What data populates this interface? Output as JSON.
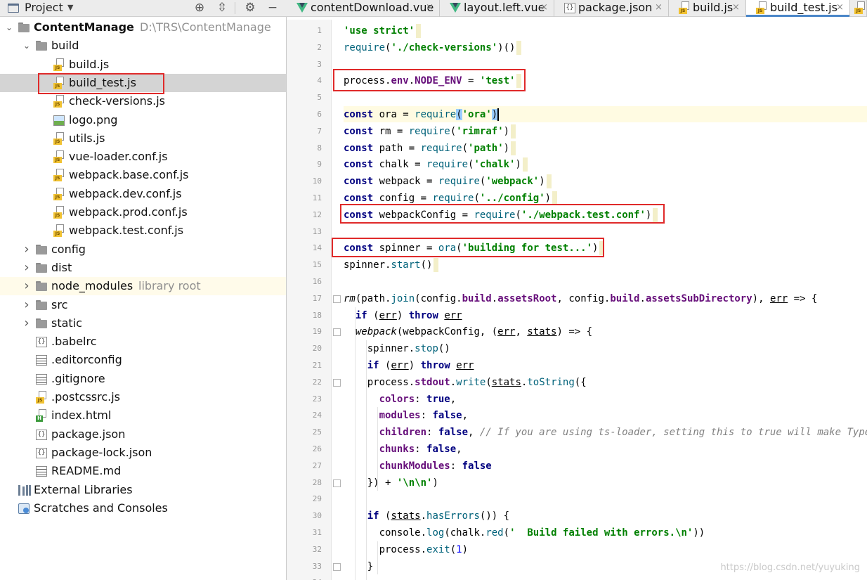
{
  "project_panel": {
    "title": "Project",
    "tree": [
      {
        "label": "ContentManage",
        "path": "D:\\TRS\\ContentManage",
        "type": "root-folder"
      },
      {
        "label": "build",
        "type": "folder"
      },
      {
        "label": "build.js",
        "type": "js"
      },
      {
        "label": "build_test.js",
        "type": "js"
      },
      {
        "label": "check-versions.js",
        "type": "js"
      },
      {
        "label": "logo.png",
        "type": "png"
      },
      {
        "label": "utils.js",
        "type": "js"
      },
      {
        "label": "vue-loader.conf.js",
        "type": "js"
      },
      {
        "label": "webpack.base.conf.js",
        "type": "js"
      },
      {
        "label": "webpack.dev.conf.js",
        "type": "js"
      },
      {
        "label": "webpack.prod.conf.js",
        "type": "js"
      },
      {
        "label": "webpack.test.conf.js",
        "type": "js"
      },
      {
        "label": "config",
        "type": "folder"
      },
      {
        "label": "dist",
        "type": "folder"
      },
      {
        "label": "node_modules",
        "suffix": "library root",
        "type": "folder"
      },
      {
        "label": "src",
        "type": "folder"
      },
      {
        "label": "static",
        "type": "folder"
      },
      {
        "label": ".babelrc",
        "type": "json"
      },
      {
        "label": ".editorconfig",
        "type": "text"
      },
      {
        "label": ".gitignore",
        "type": "text"
      },
      {
        "label": ".postcssrc.js",
        "type": "js"
      },
      {
        "label": "index.html",
        "type": "html"
      },
      {
        "label": "package.json",
        "type": "json"
      },
      {
        "label": "package-lock.json",
        "type": "json"
      },
      {
        "label": "README.md",
        "type": "text"
      },
      {
        "label": "External Libraries",
        "type": "libraries"
      },
      {
        "label": "Scratches and Consoles",
        "type": "scratches"
      }
    ]
  },
  "editor": {
    "tabs": [
      {
        "label": "contentDownload.vue",
        "type": "vue"
      },
      {
        "label": "layout.left.vue",
        "type": "vue"
      },
      {
        "label": "package.json",
        "type": "json"
      },
      {
        "label": "build.js",
        "type": "js"
      },
      {
        "label": "build_test.js",
        "type": "js"
      }
    ],
    "line_numbers": [
      "1",
      "2",
      "3",
      "4",
      "5",
      "6",
      "7",
      "8",
      "9",
      "10",
      "11",
      "12",
      "13",
      "14",
      "15",
      "16",
      "17",
      "18",
      "19",
      "20",
      "21",
      "22",
      "23",
      "24",
      "25",
      "26",
      "27",
      "28",
      "29",
      "30",
      "31",
      "32",
      "33",
      "34"
    ],
    "code": [
      "'use strict'",
      "require('./check-versions')()",
      "",
      "process.env.NODE_ENV = 'test'",
      "",
      "const ora = require('ora')",
      "const rm = require('rimraf')",
      "const path = require('path')",
      "const chalk = require('chalk')",
      "const webpack = require('webpack')",
      "const config = require('../config')",
      "const webpackConfig = require('./webpack.test.conf')",
      "",
      "const spinner = ora('building for test...')",
      "spinner.start()",
      "",
      "rm(path.join(config.build.assetsRoot, config.build.assetsSubDirectory), err => {",
      "  if (err) throw err",
      "  webpack(webpackConfig, (err, stats) => {",
      "    spinner.stop()",
      "    if (err) throw err",
      "    process.stdout.write(stats.toString({",
      "      colors: true,",
      "      modules: false,",
      "      children: false, // If you are using ts-loader, setting this to true will make TypeScript errors show up during build.",
      "      chunks: false,",
      "      chunkModules: false",
      "    }) + '\\n\\n')",
      "",
      "    if (stats.hasErrors()) {",
      "      console.log(chalk.red('  Build failed with errors.\\n'))",
      "      process.exit(1)",
      "    }",
      ""
    ]
  },
  "watermark": "https://blog.csdn.net/yuyuking"
}
